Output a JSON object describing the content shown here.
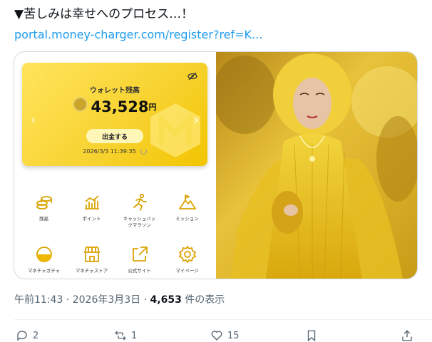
{
  "tweet": {
    "text": "▼苦しみは幸せへのプロセス…！",
    "link": "portal.money-charger.com/register?ref=K..."
  },
  "card": {
    "wallet": {
      "title": "ウォレット残高",
      "amount": "43,528",
      "currency": "円",
      "withdraw_label": "出金する",
      "timestamp": "2026/3/3 11:39:35"
    },
    "menu": [
      {
        "label": "残高",
        "icon": "coins-icon"
      },
      {
        "label": "ポイント",
        "icon": "chart-icon"
      },
      {
        "label": "キャッシュバックマラソン",
        "label_line1": "キャッシュバッ",
        "label_line2": "クマラソン",
        "icon": "runner-icon"
      },
      {
        "label": "ミッション",
        "icon": "mountain-icon"
      },
      {
        "label": "マネチャガチャ",
        "icon": "gacha-icon"
      },
      {
        "label": "マネチャストア",
        "icon": "store-icon"
      },
      {
        "label": "公式サイト",
        "icon": "external-link-icon"
      },
      {
        "label": "マイページ",
        "icon": "gear-icon"
      }
    ]
  },
  "meta": {
    "time": "午前11:43",
    "date": "2026年3月3日",
    "views": "4,653",
    "views_suffix": "件の表示"
  },
  "actions": {
    "replies": "2",
    "reposts": "1",
    "likes": "15"
  },
  "colors": {
    "link": "#1d9bf0",
    "gold": "#e0a800",
    "wallet": "#f7d22e"
  }
}
